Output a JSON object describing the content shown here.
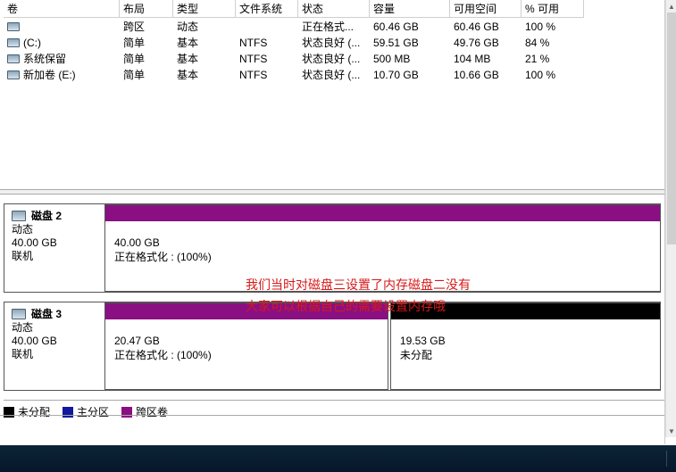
{
  "columns": {
    "vol": "卷",
    "layout": "布局",
    "type": "类型",
    "fs": "文件系统",
    "status": "状态",
    "cap": "容量",
    "free": "可用空间",
    "pct": "% 可用"
  },
  "volumes": [
    {
      "name": "",
      "layout": "跨区",
      "type": "动态",
      "fs": "",
      "status": "正在格式...",
      "cap": "60.46 GB",
      "free": "60.46 GB",
      "pct": "100 %"
    },
    {
      "name": "(C:)",
      "layout": "简单",
      "type": "基本",
      "fs": "NTFS",
      "status": "状态良好 (...",
      "cap": "59.51 GB",
      "free": "49.76 GB",
      "pct": "84 %"
    },
    {
      "name": "系统保留",
      "layout": "简单",
      "type": "基本",
      "fs": "NTFS",
      "status": "状态良好 (...",
      "cap": "500 MB",
      "free": "104 MB",
      "pct": "21 %"
    },
    {
      "name": "新加卷 (E:)",
      "layout": "简单",
      "type": "基本",
      "fs": "NTFS",
      "status": "状态良好 (...",
      "cap": "10.70 GB",
      "free": "10.66 GB",
      "pct": "100 %"
    }
  ],
  "annotation": {
    "line1": "我们当时对磁盘三设置了内存磁盘二没有",
    "line2": "大家可以根据自己的需要设置内存哦"
  },
  "disks": [
    {
      "title": "磁盘 2",
      "dyn": "动态",
      "size": "40.00 GB",
      "state": "联机",
      "parts": [
        {
          "size": "40.00 GB",
          "status": "正在格式化 : (100%)",
          "color": "span",
          "flex": 1
        }
      ]
    },
    {
      "title": "磁盘 3",
      "dyn": "动态",
      "size": "40.00 GB",
      "state": "联机",
      "parts": [
        {
          "size": "20.47 GB",
          "status": "正在格式化 : (100%)",
          "color": "span",
          "flex": 0.512
        },
        {
          "size": "19.53 GB",
          "status": "未分配",
          "color": "unalloc",
          "flex": 0.488
        }
      ]
    }
  ],
  "legend": {
    "unalloc": "未分配",
    "primary": "主分区",
    "span": "跨区卷"
  }
}
